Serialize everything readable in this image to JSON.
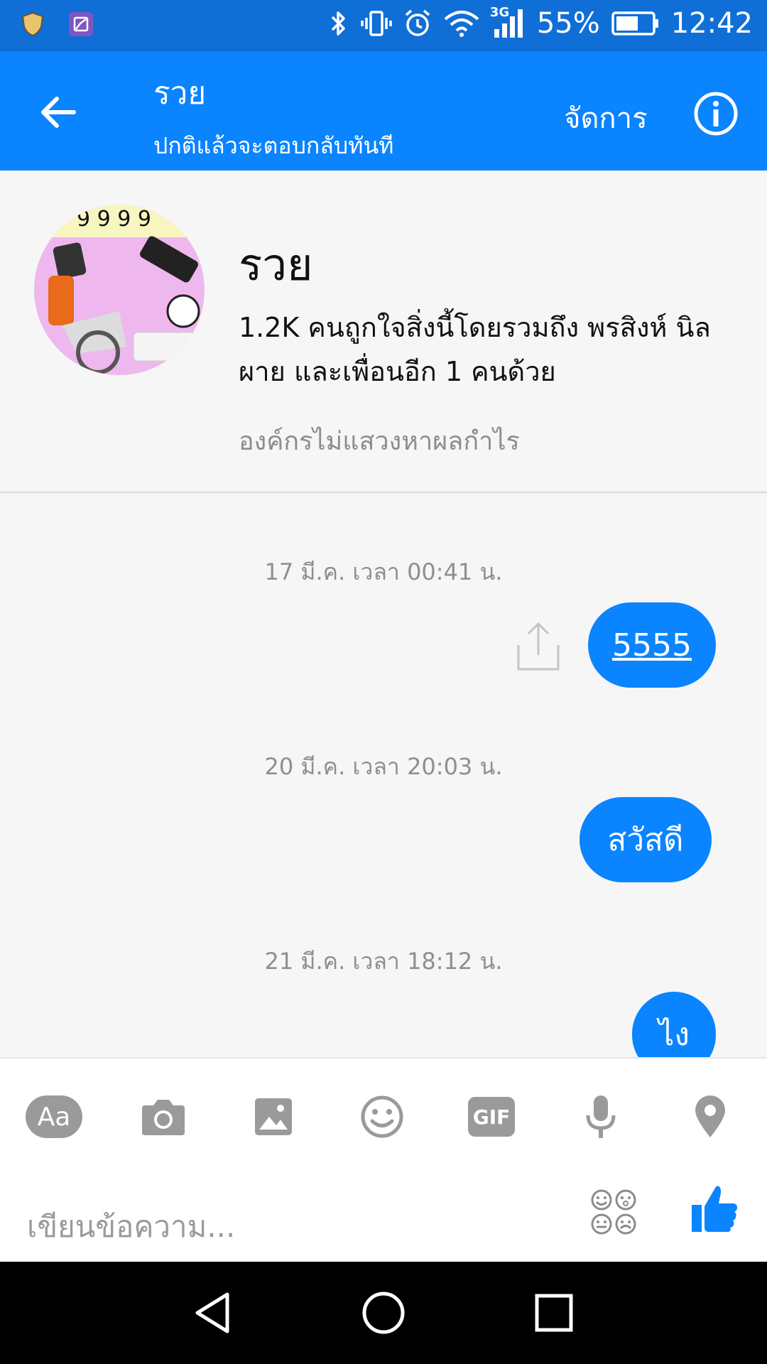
{
  "status_bar": {
    "battery": "55%",
    "time": "12:42",
    "network": "3G",
    "icons": [
      "shield-icon",
      "gallery-icon",
      "bluetooth-icon",
      "vibrate-icon",
      "alarm-icon",
      "wifi-icon",
      "signal-icon",
      "battery-icon"
    ]
  },
  "header": {
    "title": "รวย",
    "subtitle": "ปกติแล้วจะตอบกลับทันที",
    "manage_label": "จัดการ"
  },
  "profile": {
    "name": "รวย",
    "likes": "1.2K คนถูกใจสิ่งนี้โดยรวมถึง พรสิงห์ นิลผาย และเพื่อนอีก 1 คนด้วย",
    "category": "องค์กรไม่แสวงหาผลกำไร"
  },
  "messages": [
    {
      "timestamp": "17 มี.ค. เวลา 00:41 น.",
      "text": "5555"
    },
    {
      "timestamp": "20 มี.ค. เวลา 20:03 น.",
      "text": "สวัสดี"
    },
    {
      "timestamp": "21 มี.ค. เวลา 18:12 น.",
      "text": "ไง"
    }
  ],
  "composer": {
    "aa_label": "Aa",
    "gif_label": "GIF",
    "placeholder": "เขียนข้อความ..."
  },
  "colors": {
    "status_bar": "#0f6fd6",
    "header": "#0a84ff",
    "bubble": "#0a84ff",
    "tool_icon": "#9a9a9a"
  }
}
